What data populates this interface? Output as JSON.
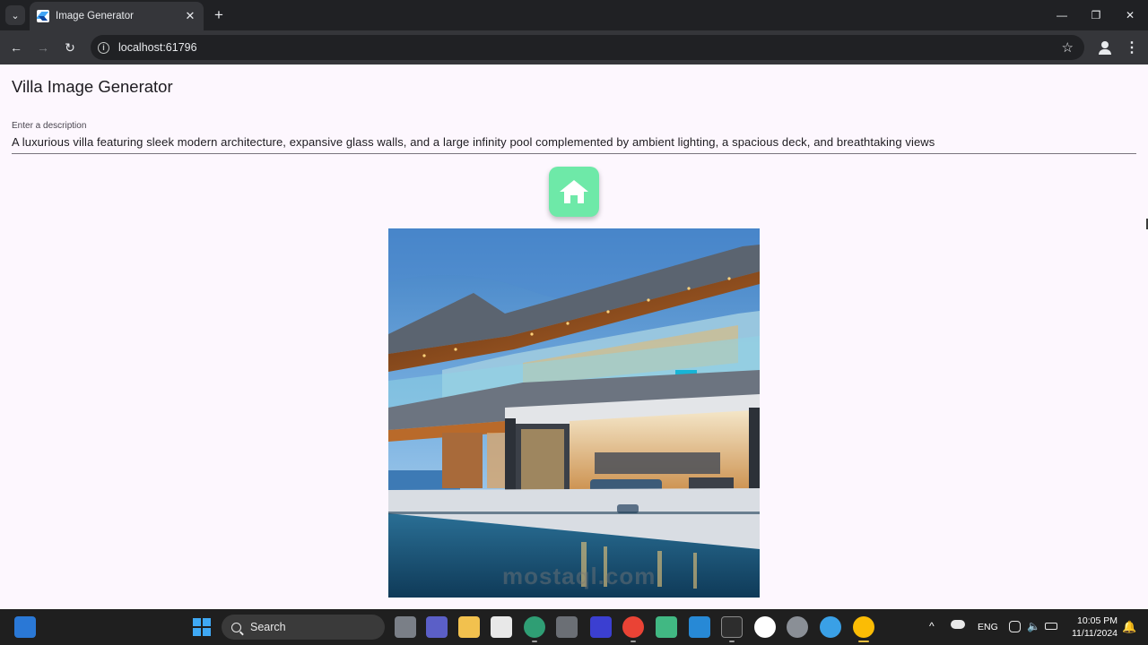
{
  "browser": {
    "tab_title": "Image Generator",
    "tab_close": "✕",
    "new_tab": "+",
    "url": "localhost:61796",
    "window_controls": [
      "—",
      "❐",
      "✕"
    ]
  },
  "app": {
    "title": "Villa Image Generator",
    "prompt_label": "Enter a description",
    "prompt_value": "A luxurious villa featuring sleek modern architecture, expansive glass walls, and a large infinity pool complemented by ambient lighting, a spacious deck, and breathtaking views",
    "generate_icon": "home-icon",
    "generate_color": "#6ee9a8"
  },
  "taskbar": {
    "search_label": "Search",
    "language": "ENG",
    "time": "10:05 PM",
    "date": "11/11/2024"
  },
  "watermark": "mostaql.com"
}
